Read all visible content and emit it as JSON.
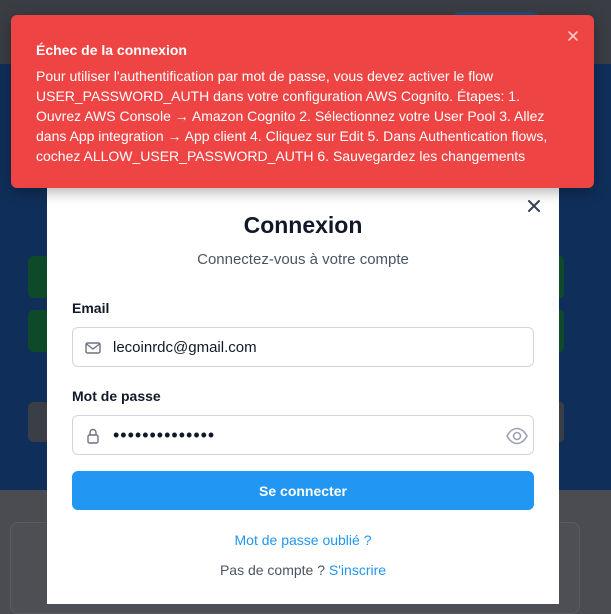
{
  "toast": {
    "title": "Échec de la connexion",
    "message": "Pour utiliser l'authentification par mot de passe, vous devez activer le flow USER_PASSWORD_AUTH dans votre configuration AWS Cognito. Étapes: 1. Ouvrez AWS Console → Amazon Cognito 2. Sélectionnez votre User Pool 3. Allez dans App integration → App client 4. Cliquez sur Edit 5. Dans Authentication flows, cochez ALLOW_USER_PASSWORD_AUTH 6. Sauvegardez les changements",
    "close_icon": "close-icon",
    "color": "#ef4444"
  },
  "login": {
    "title": "Connexion",
    "subtitle": "Connectez-vous à votre compte",
    "close_icon": "close-icon",
    "email": {
      "label": "Email",
      "value": "lecoinrdc@gmail.com",
      "icon": "mail-icon"
    },
    "password": {
      "label": "Mot de passe",
      "value": "••••••••••••••",
      "icon": "lock-icon",
      "toggle_icon": "eye-icon"
    },
    "submit_label": "Se connecter",
    "forgot_link": "Mot de passe oublié ?",
    "no_account_text": "Pas de compte ?",
    "signup_link": "S'inscrire",
    "accent_color": "#2196f3"
  }
}
